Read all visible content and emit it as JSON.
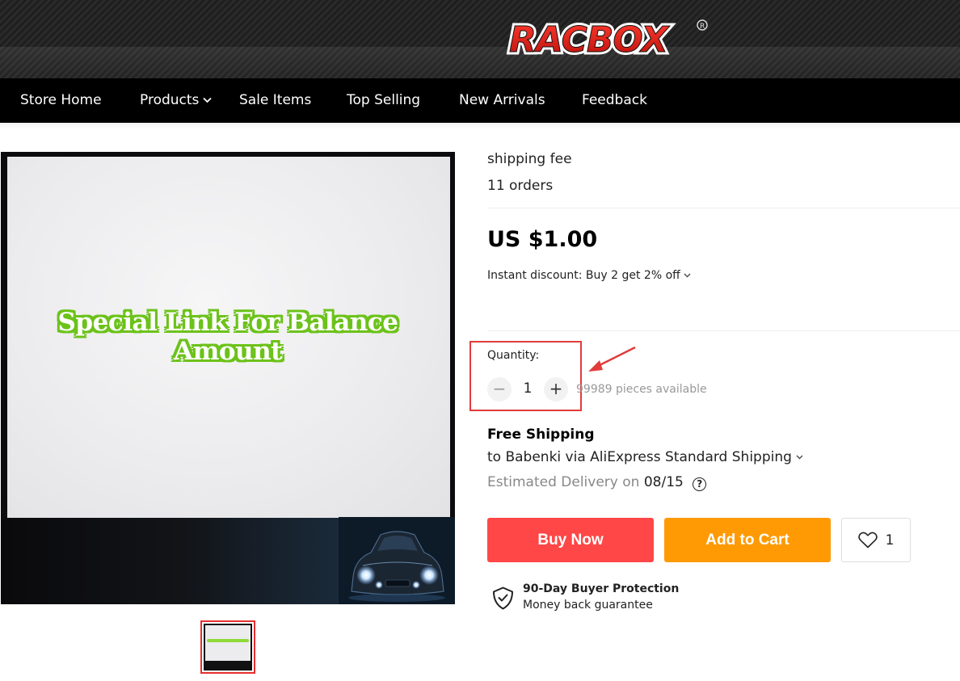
{
  "header": {
    "logo_text": "RACBOX",
    "brand_color": "#e2231a"
  },
  "nav": {
    "items": [
      {
        "label": "Store Home"
      },
      {
        "label": "Products",
        "has_dropdown": true
      },
      {
        "label": "Sale Items"
      },
      {
        "label": "Top Selling"
      },
      {
        "label": "New Arrivals"
      },
      {
        "label": "Feedback"
      }
    ]
  },
  "gallery": {
    "main_image_text": "Special Link For Balance Amount",
    "thumbnail_count": 1,
    "selected_thumbnail": 1
  },
  "product": {
    "title": "shipping fee",
    "orders": "11 orders",
    "price": "US $1.00",
    "discount": "Instant discount: Buy 2 get 2% off"
  },
  "quantity": {
    "label": "Quantity:",
    "value": "1",
    "minus_symbol": "−",
    "plus_symbol": "+",
    "available": "99989 pieces available"
  },
  "shipping": {
    "title": "Free Shipping",
    "via": "to Babenki via AliExpress Standard Shipping",
    "delivery_prefix": "Estimated Delivery on",
    "delivery_date": "08/15"
  },
  "actions": {
    "buy_now": "Buy Now",
    "add_to_cart": "Add to Cart",
    "wishlist_count": "1",
    "buy_color": "#ff4747",
    "cart_color": "#ff9a05"
  },
  "protection": {
    "title": "90-Day Buyer Protection",
    "subtitle": "Money back guarantee"
  }
}
